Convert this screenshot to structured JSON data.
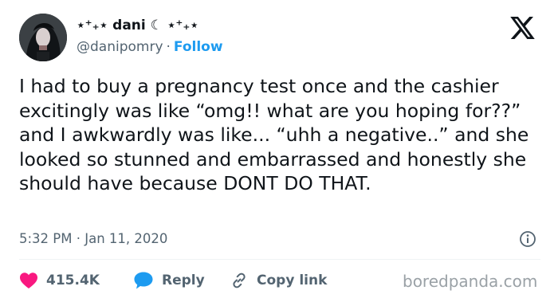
{
  "author": {
    "display_name": "⋆⁺₊⋆ dani ☾ ⋆⁺₊⋆",
    "handle": "@danipomry",
    "separator": "·",
    "follow_label": "Follow"
  },
  "tweet": {
    "text": "I had to buy a pregnancy test once and the cashier excitingly was like “omg!! what are you hoping for??” and I awkwardly was like... “uhh a negative..” and she looked so stunned and embarrassed and honestly she should have because DONT DO THAT.",
    "timestamp": "5:32 PM · Jan 11, 2020"
  },
  "actions": {
    "like_count": "415.4K",
    "reply_label": "Reply",
    "copy_link_label": "Copy link"
  },
  "watermark": "boredpanda.com",
  "icons": {
    "brand": "x-logo-icon",
    "like": "heart-icon",
    "reply": "speech-bubble-icon",
    "copy": "link-icon",
    "info": "info-icon"
  },
  "colors": {
    "text": "#0f1419",
    "secondary_text": "#536471",
    "follow_blue": "#1d9bf0",
    "like_pink": "#f91880"
  }
}
